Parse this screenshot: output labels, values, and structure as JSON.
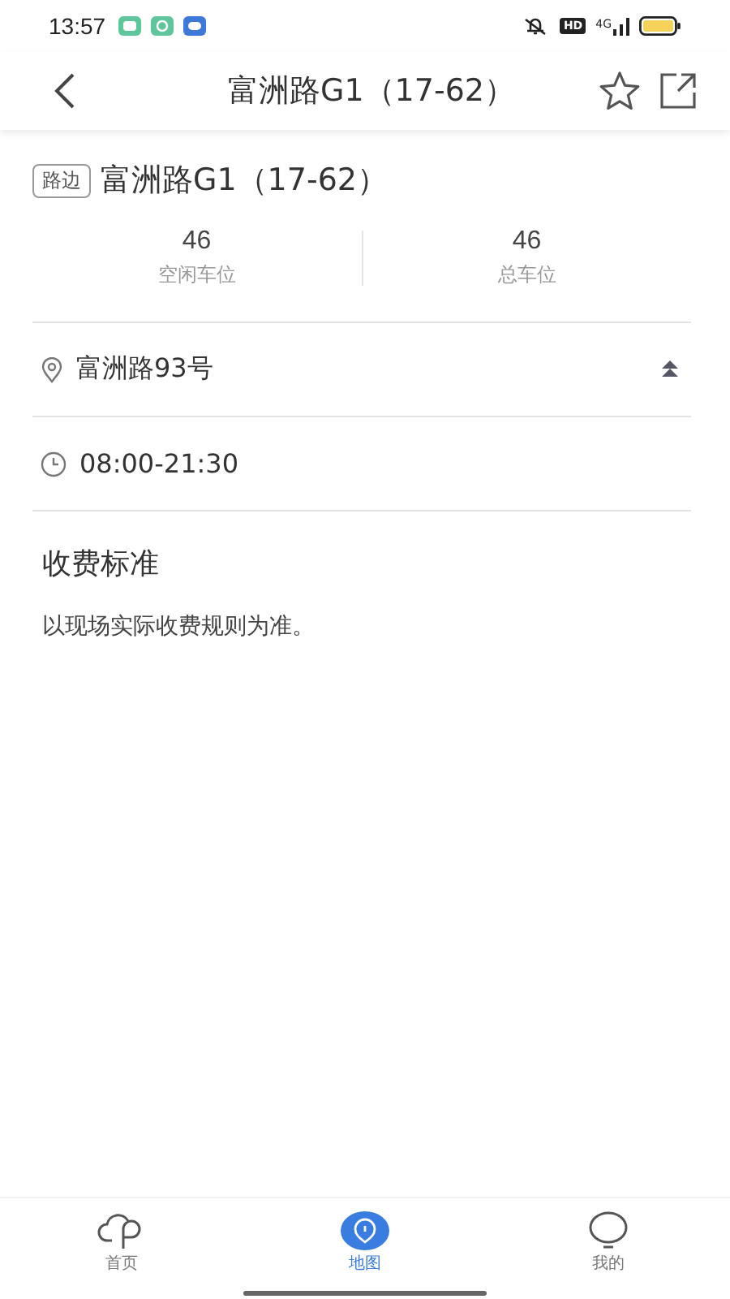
{
  "status_bar": {
    "time": "13:57",
    "hd": "HD",
    "network": "4G"
  },
  "nav": {
    "title": "富洲路G1（17-62）",
    "favorite": false
  },
  "header": {
    "tag": "路边",
    "name": "富洲路G1（17-62）"
  },
  "stats": [
    {
      "value": "46",
      "label": "空闲车位"
    },
    {
      "value": "46",
      "label": "总车位"
    }
  ],
  "address": {
    "text": "富洲路93号",
    "expanded": true
  },
  "hours": {
    "text": "08:00-21:30"
  },
  "fee": {
    "title": "收费标准",
    "text": "以现场实际收费规则为准。"
  },
  "tabs": [
    {
      "label": "首页",
      "selected": false
    },
    {
      "label": "地图",
      "selected": true
    },
    {
      "label": "我的",
      "selected": false
    }
  ]
}
